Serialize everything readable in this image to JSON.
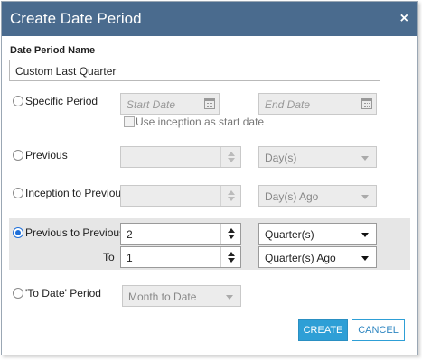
{
  "dialog": {
    "title": "Create Date Period",
    "close_glyph": "×"
  },
  "name_section": {
    "label": "Date Period Name",
    "value": "Custom Last Quarter"
  },
  "specific_period": {
    "label": "Specific Period",
    "start_placeholder": "Start Date",
    "end_placeholder": "End Date",
    "inception_checkbox_label": "Use inception as start date"
  },
  "previous": {
    "label": "Previous",
    "amount": "",
    "unit": "Day(s)"
  },
  "inception_to_previous": {
    "label": "Inception to Previous",
    "amount": "",
    "unit": "Day(s) Ago"
  },
  "previous_to_previous": {
    "label": "Previous to Previous",
    "selected": true,
    "amount": "2",
    "unit": "Quarter(s)",
    "to_label": "To",
    "to_amount": "1",
    "to_unit": "Quarter(s) Ago"
  },
  "to_date_period": {
    "label": "'To Date' Period",
    "value": "Month to Date"
  },
  "buttons": {
    "create": "CREATE",
    "cancel": "CANCEL"
  },
  "icons": {
    "close": "close-icon",
    "calendar": "calendar-icon",
    "spinner": "spinner-icon",
    "dropdown": "chevron-down-icon"
  },
  "colors": {
    "titlebar": "#4a6b8e",
    "primary_button": "#2e9fd6",
    "radio_selected": "#1e6fd9",
    "selected_row_bg": "#e6e6e6"
  }
}
